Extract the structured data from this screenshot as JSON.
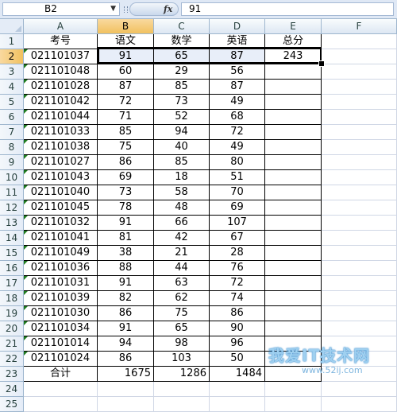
{
  "formula_bar": {
    "name_box": "B2",
    "fx_label": "fx",
    "formula": "91"
  },
  "columns": [
    "A",
    "B",
    "C",
    "D",
    "E",
    "F"
  ],
  "row_numbers": [
    "1",
    "2",
    "3",
    "4",
    "5",
    "6",
    "7",
    "8",
    "9",
    "10",
    "11",
    "12",
    "13",
    "14",
    "15",
    "16",
    "17",
    "18",
    "19",
    "20",
    "21",
    "22",
    "23",
    "24",
    "25"
  ],
  "selected_cell": "B2",
  "table": {
    "headers": [
      "考号",
      "语文",
      "数学",
      "英语",
      "总分"
    ],
    "rows": [
      [
        "021101037",
        "91",
        "65",
        "87",
        "243"
      ],
      [
        "021101048",
        "60",
        "29",
        "56",
        ""
      ],
      [
        "021101028",
        "87",
        "85",
        "87",
        ""
      ],
      [
        "021101042",
        "72",
        "73",
        "49",
        ""
      ],
      [
        "021101044",
        "71",
        "52",
        "68",
        ""
      ],
      [
        "021101033",
        "85",
        "94",
        "72",
        ""
      ],
      [
        "021101038",
        "75",
        "40",
        "49",
        ""
      ],
      [
        "021101027",
        "86",
        "85",
        "80",
        ""
      ],
      [
        "021101043",
        "69",
        "18",
        "51",
        ""
      ],
      [
        "021101040",
        "73",
        "58",
        "70",
        ""
      ],
      [
        "021101045",
        "78",
        "48",
        "69",
        ""
      ],
      [
        "021101032",
        "91",
        "66",
        "107",
        ""
      ],
      [
        "021101041",
        "81",
        "42",
        "67",
        ""
      ],
      [
        "021101049",
        "38",
        "21",
        "28",
        ""
      ],
      [
        "021101036",
        "88",
        "44",
        "76",
        ""
      ],
      [
        "021101031",
        "91",
        "63",
        "72",
        ""
      ],
      [
        "021101039",
        "82",
        "62",
        "74",
        ""
      ],
      [
        "021101030",
        "86",
        "75",
        "86",
        ""
      ],
      [
        "021101034",
        "91",
        "65",
        "90",
        ""
      ],
      [
        "021101014",
        "94",
        "98",
        "96",
        ""
      ],
      [
        "021101024",
        "86",
        "103",
        "50",
        ""
      ]
    ],
    "total_row": [
      "合计",
      "1675",
      "1286",
      "1484",
      ""
    ]
  },
  "watermark": {
    "title": "我爱IT技术网",
    "url": "www.52ij.com"
  }
}
